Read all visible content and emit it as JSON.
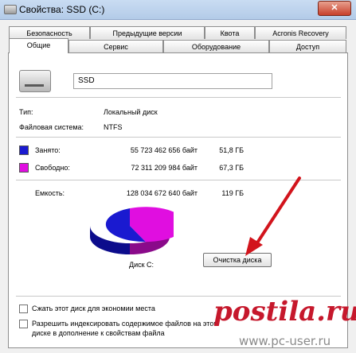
{
  "window": {
    "title": "Свойства: SSD (C:)",
    "close": "✕"
  },
  "tabs_back": [
    "Безопасность",
    "Предыдущие версии",
    "Квота",
    "Acronis Recovery"
  ],
  "tabs_front": [
    "Общие",
    "Сервис",
    "Оборудование",
    "Доступ"
  ],
  "general": {
    "name": "SSD",
    "type_label": "Тип:",
    "type_value": "Локальный диск",
    "fs_label": "Файловая система:",
    "fs_value": "NTFS",
    "used_label": "Занято:",
    "used_bytes": "55 723 462 656 байт",
    "used_gb": "51,8 ГБ",
    "free_label": "Свободно:",
    "free_bytes": "72 311 209 984 байт",
    "free_gb": "67,3 ГБ",
    "cap_label": "Емкость:",
    "cap_bytes": "128 034 672 640 байт",
    "cap_gb": "119 ГБ",
    "disk_label": "Диск C:",
    "cleanup_button": "Очистка диска",
    "compress_label": "Сжать этот диск для экономии места",
    "index_label_1": "Разрешить индексировать содержимое файлов на этом",
    "index_label_2": "диске в дополнение к свойствам файла"
  },
  "colors": {
    "used": "#1a1ad0",
    "free": "#e00ee0"
  },
  "used_fraction": 0.435,
  "watermark": {
    "brand": "postila.ru",
    "site": "www.pc-user.ru"
  }
}
